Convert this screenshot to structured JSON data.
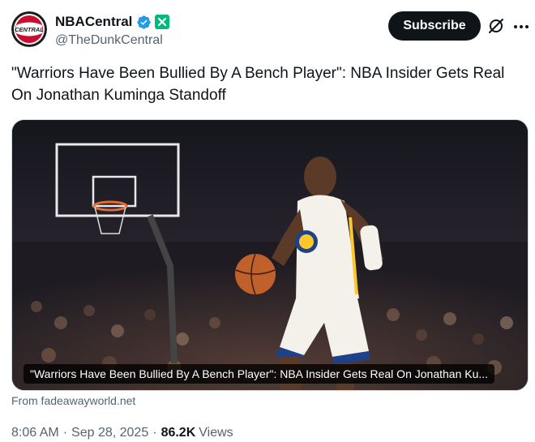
{
  "author": {
    "display_name": "NBACentral",
    "handle": "@TheDunkCentral",
    "avatar_text": "CENTRAL",
    "verified": true,
    "affiliate_badge": true
  },
  "actions": {
    "subscribe_label": "Subscribe",
    "grok_icon": "grok-icon",
    "more_icon": "more-icon"
  },
  "tweet": {
    "text": "\"Warriors Have Been Bullied By A Bench Player\": NBA Insider Gets Real On Jonathan Kuminga Standoff"
  },
  "media": {
    "caption": "\"Warriors Have Been Bullied By A Bench Player\": NBA Insider Gets Real On Jonathan Ku...",
    "source": "From fadeawayworld.net"
  },
  "meta": {
    "time": "8:06 AM",
    "date": "Sep 28, 2025",
    "views_count": "86.2K",
    "views_label": "Views"
  },
  "colors": {
    "verified_blue": "#1d9bf0",
    "affiliate_green": "#00ba7c",
    "text_primary": "#0f1419",
    "text_secondary": "#536471"
  }
}
